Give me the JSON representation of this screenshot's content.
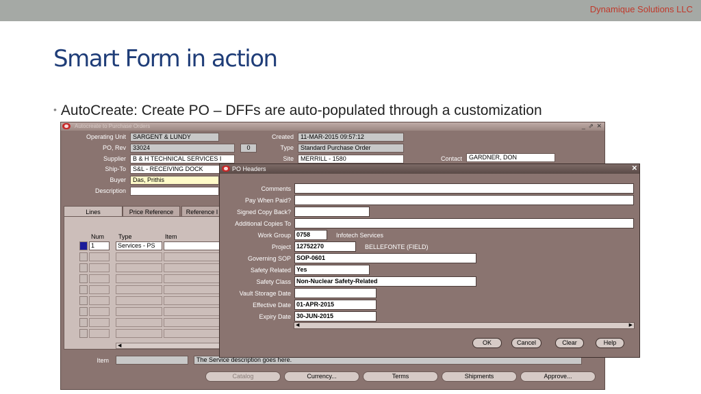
{
  "slide": {
    "company": "Dynamique Solutions LLC",
    "title": "Smart Form in action",
    "bullet": "AutoCreate: Create PO – DFFs are auto-populated through a customization"
  },
  "window": {
    "title": "Autocreate to Purchase Orders",
    "header": {
      "operating_unit_label": "Operating Unit",
      "operating_unit": "SARGENT & LUNDY",
      "po_rev_label": "PO, Rev",
      "po_number": "33024",
      "revision": "0",
      "supplier_label": "Supplier",
      "supplier": "B & H TECHNICAL SERVICES I",
      "ship_to_label": "Ship-To",
      "ship_to": "S&L - RECEIVING DOCK",
      "buyer_label": "Buyer",
      "buyer": "Das, Prithis",
      "description_label": "Description",
      "description": "",
      "created_label": "Created",
      "created": "11-MAR-2015 09:57:12",
      "type_label": "Type",
      "type": "Standard Purchase Order",
      "site_label": "Site",
      "site": "MERRILL - 1580",
      "contact_label": "Contact",
      "contact": "GARDNER, DON"
    },
    "tabs": [
      "Lines",
      "Price Reference",
      "Reference I"
    ],
    "lines": {
      "columns": [
        "Num",
        "Type",
        "Item"
      ],
      "rows": [
        {
          "num": "1",
          "type": "Services - PS",
          "item": ""
        }
      ]
    },
    "item_label": "Item",
    "item_description": "The Service description goes here.",
    "buttons": [
      "Catalog",
      "Currency...",
      "Terms",
      "Shipments",
      "Approve..."
    ]
  },
  "dialog": {
    "title": "PO Headers",
    "fields": [
      {
        "label": "Comments",
        "value": ""
      },
      {
        "label": "Pay When Paid?",
        "value": ""
      },
      {
        "label": "Signed Copy Back?",
        "value": ""
      },
      {
        "label": "Additional Copies To",
        "value": ""
      },
      {
        "label": "Work Group",
        "value": "0758",
        "desc": "Infotech Services"
      },
      {
        "label": "Project",
        "value": "12752270",
        "desc": "BELLEFONTE (FIELD)"
      },
      {
        "label": "Governing SOP",
        "value": "SOP-0601"
      },
      {
        "label": "Safety Related",
        "value": "Yes"
      },
      {
        "label": "Safety Class",
        "value": "Non-Nuclear Safety-Related"
      },
      {
        "label": "Vault Storage Date",
        "value": ""
      },
      {
        "label": "Effective Date",
        "value": "01-APR-2015"
      },
      {
        "label": "Expiry Date",
        "value": "30-JUN-2015"
      }
    ],
    "buttons": {
      "ok": "OK",
      "cancel": "Cancel",
      "clear": "Clear",
      "help": "Help"
    }
  }
}
